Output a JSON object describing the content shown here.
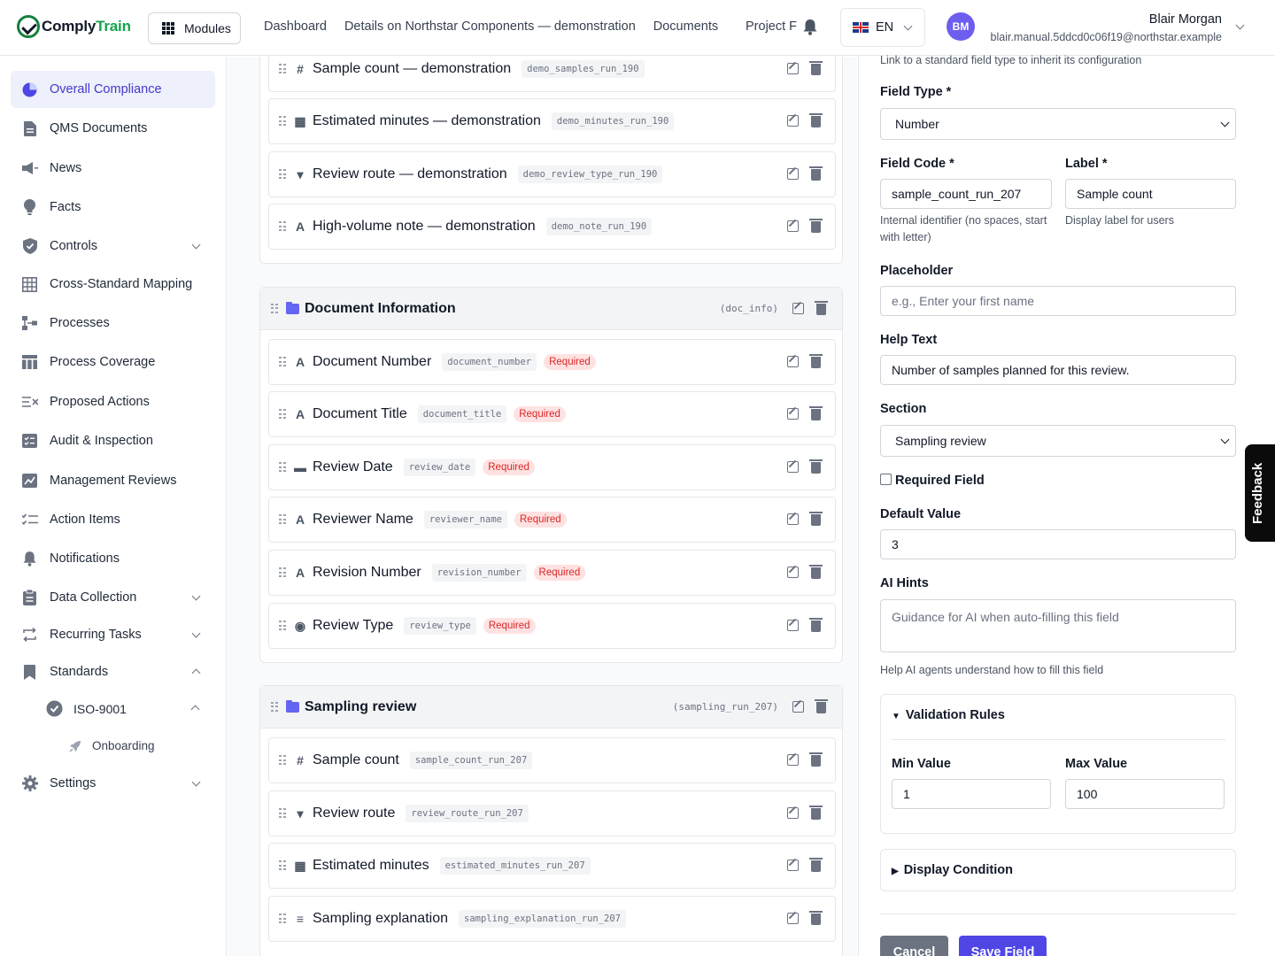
{
  "brand": {
    "name_part1": "Comply",
    "name_part2": "Train"
  },
  "topbar": {
    "modules_label": "Modules",
    "nav": [
      "Dashboard",
      "Details on Northstar Components — demonstration",
      "Documents"
    ],
    "nav_truncated": "Project F",
    "language": "EN",
    "user": {
      "initials": "BM",
      "name": "Blair Morgan",
      "email": "blair.manual.5ddcd0c06f19@northstar.example"
    }
  },
  "sidebar": {
    "items": [
      {
        "label": "Overall Compliance",
        "icon": "pie-chart-icon",
        "active": true
      },
      {
        "label": "QMS Documents",
        "icon": "document-icon"
      },
      {
        "label": "News",
        "icon": "megaphone-icon"
      },
      {
        "label": "Facts",
        "icon": "lightbulb-icon"
      },
      {
        "label": "Controls",
        "icon": "shield-icon",
        "caret": "down"
      },
      {
        "label": "Cross-Standard Mapping",
        "icon": "table-icon"
      },
      {
        "label": "Processes",
        "icon": "process-icon"
      },
      {
        "label": "Process Coverage",
        "icon": "columns-icon"
      },
      {
        "label": "Proposed Actions",
        "icon": "list-x-icon"
      },
      {
        "label": "Audit & Inspection",
        "icon": "audit-icon"
      },
      {
        "label": "Management Reviews",
        "icon": "review-icon"
      },
      {
        "label": "Action Items",
        "icon": "checklist-icon"
      },
      {
        "label": "Notifications",
        "icon": "bell-icon"
      },
      {
        "label": "Data Collection",
        "icon": "clipboard-icon",
        "caret": "down"
      },
      {
        "label": "Recurring Tasks",
        "icon": "repeat-icon",
        "caret": "down"
      },
      {
        "label": "Standards",
        "icon": "bookmark-icon",
        "caret": "up"
      },
      {
        "label": "Settings",
        "icon": "gear-icon",
        "caret": "down"
      }
    ],
    "standard_child": "ISO-9001",
    "standard_grandchild": "Onboarding"
  },
  "sections": {
    "top_fields": [
      {
        "type": "#",
        "name": "Sample count — demonstration",
        "code": "demo_samples_run_190"
      },
      {
        "type": "▦",
        "name": "Estimated minutes — demonstration",
        "code": "demo_minutes_run_190"
      },
      {
        "type": "▾",
        "name": "Review route — demonstration",
        "code": "demo_review_type_run_190"
      },
      {
        "type": "A",
        "name": "High-volume note — demonstration",
        "code": "demo_note_run_190"
      }
    ],
    "doc_info": {
      "title": "Document Information",
      "code": "(doc_info)",
      "required_label": "Required",
      "fields": [
        {
          "type": "A",
          "name": "Document Number",
          "code": "document_number"
        },
        {
          "type": "A",
          "name": "Document Title",
          "code": "document_title"
        },
        {
          "type": "▬",
          "name": "Review Date",
          "code": "review_date"
        },
        {
          "type": "A",
          "name": "Reviewer Name",
          "code": "reviewer_name"
        },
        {
          "type": "A",
          "name": "Revision Number",
          "code": "revision_number"
        },
        {
          "type": "◉",
          "name": "Review Type",
          "code": "review_type"
        }
      ]
    },
    "sampling": {
      "title": "Sampling review",
      "code": "(sampling_run_207)",
      "fields": [
        {
          "type": "#",
          "name": "Sample count",
          "code": "sample_count_run_207"
        },
        {
          "type": "▾",
          "name": "Review route",
          "code": "review_route_run_207"
        },
        {
          "type": "▦",
          "name": "Estimated minutes",
          "code": "estimated_minutes_run_207"
        },
        {
          "type": "≡",
          "name": "Sampling explanation",
          "code": "sampling_explanation_run_207"
        }
      ]
    }
  },
  "form": {
    "standard_hint": "Link to a standard field type to inherit its configuration",
    "field_type_label": "Field Type *",
    "field_type_value": "Number",
    "field_code_label": "Field Code *",
    "field_code_value": "sample_count_run_207",
    "field_code_hint": "Internal identifier (no spaces, start with letter)",
    "label_label": "Label *",
    "label_value": "Sample count",
    "label_hint": "Display label for users",
    "placeholder_label": "Placeholder",
    "placeholder_placeholder": "e.g., Enter your first name",
    "help_label": "Help Text",
    "help_value": "Number of samples planned for this review.",
    "section_label": "Section",
    "section_value": "Sampling review",
    "required_label": "Required Field",
    "default_label": "Default Value",
    "default_value": "3",
    "ai_label": "AI Hints",
    "ai_placeholder": "Guidance for AI when auto-filling this field",
    "ai_hint": "Help AI agents understand how to fill this field",
    "validation_title": "Validation Rules",
    "min_label": "Min Value",
    "min_value": "1",
    "max_label": "Max Value",
    "max_value": "100",
    "display_condition": "Display Condition",
    "cancel": "Cancel",
    "save": "Save Field"
  },
  "feedback": "Feedback"
}
